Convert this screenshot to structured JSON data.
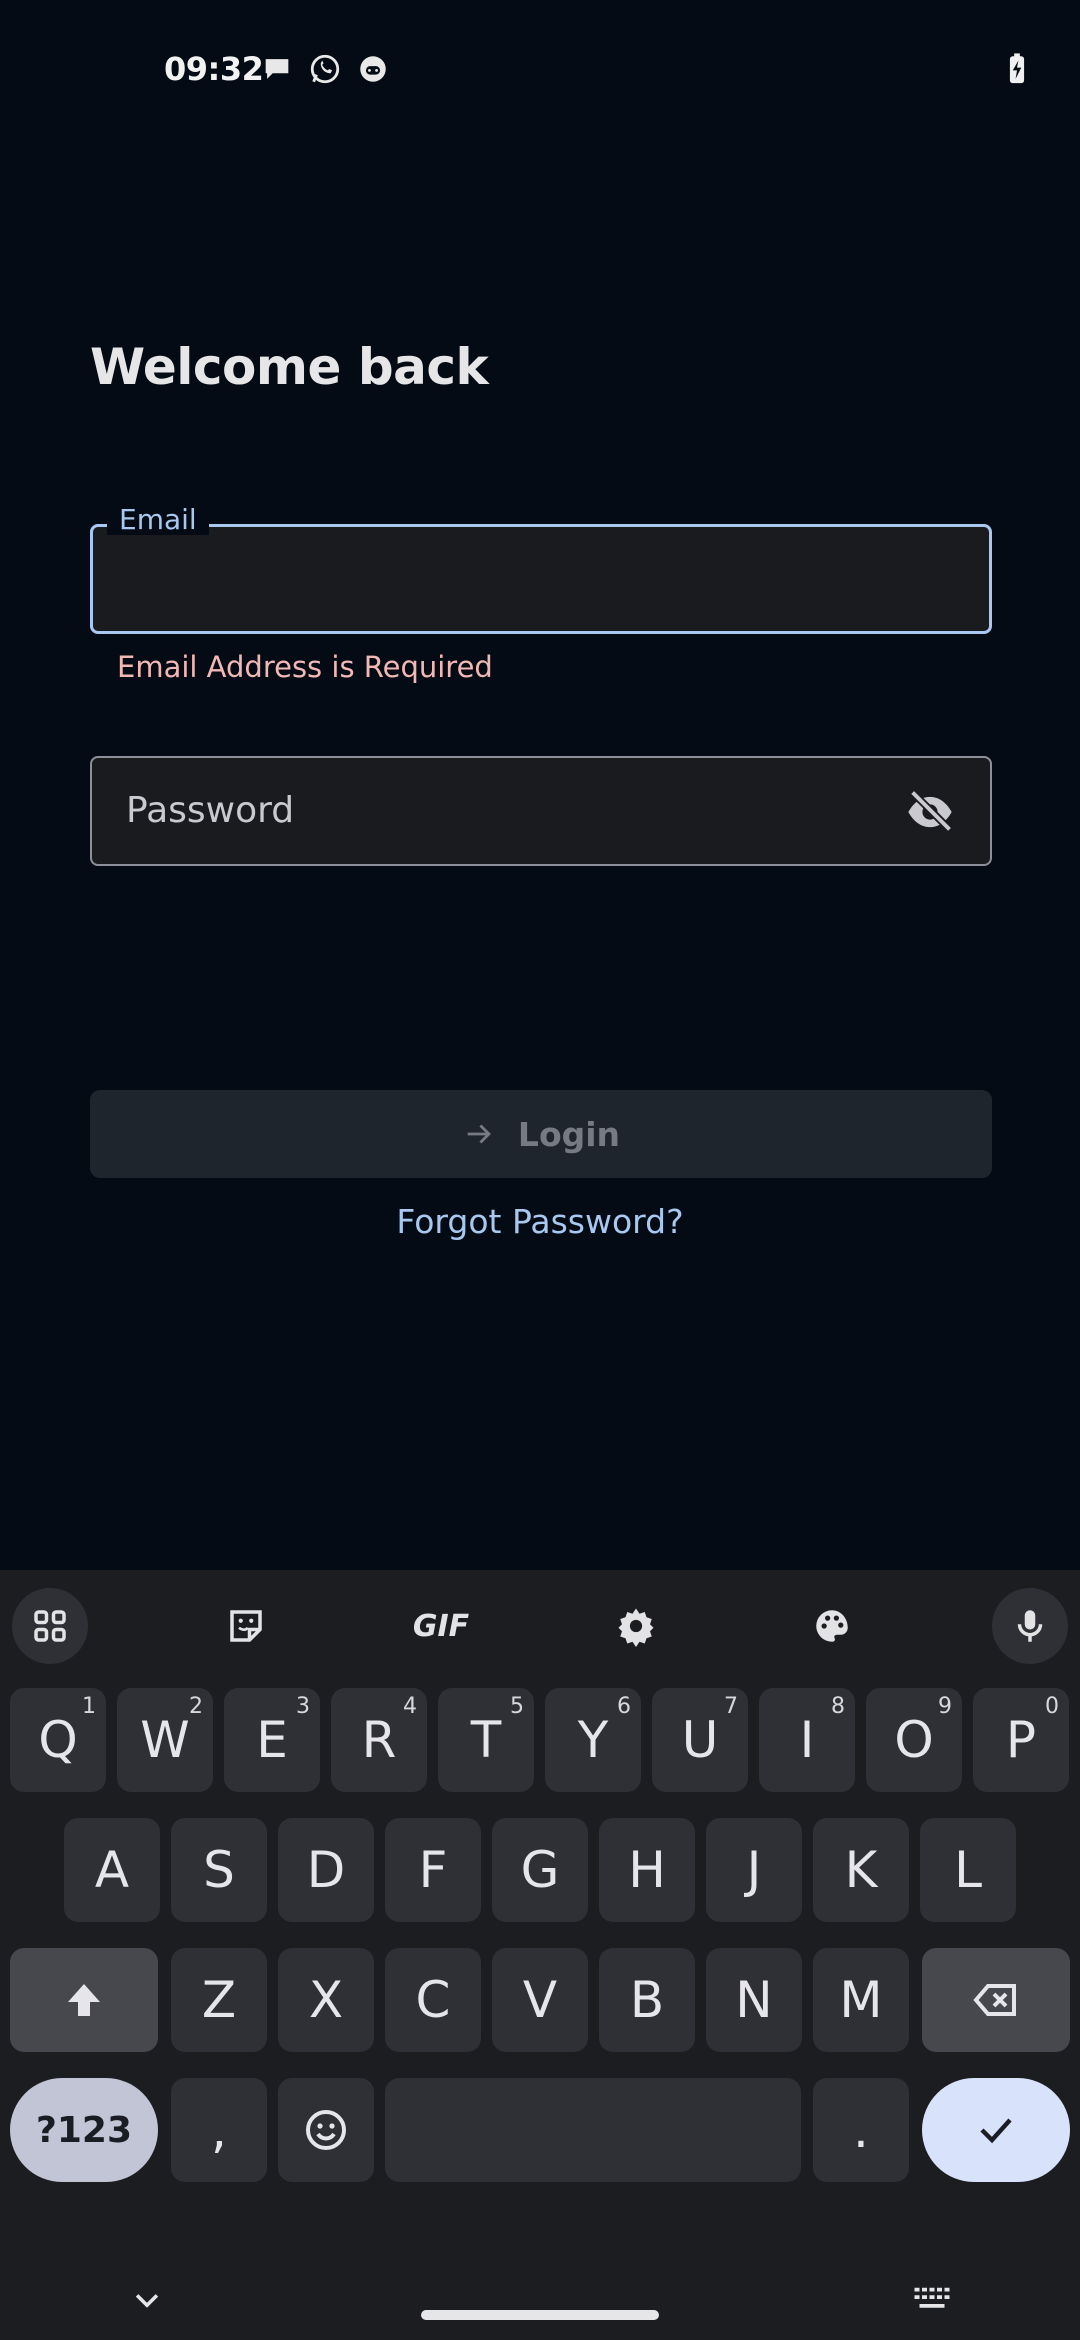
{
  "status_bar": {
    "time": "09:32",
    "icons": [
      "chat-bubble-icon",
      "whatsapp-icon",
      "assistant-icon"
    ],
    "battery": "battery-charging-icon"
  },
  "login": {
    "title": "Welcome back",
    "email_label": "Email",
    "email_value": "",
    "email_error": "Email Address is Required",
    "password_placeholder": "Password",
    "password_visibility_icon": "eye-off-icon",
    "login_label": "Login",
    "forgot_password": "Forgot Password?"
  },
  "colors": {
    "background": "#040b14",
    "accent": "#a8c8f0",
    "error": "#f2b8b5",
    "button_disabled": "#1f252d"
  },
  "keyboard": {
    "toolbar": [
      "apps-grid-icon",
      "sticker-icon",
      "GIF",
      "settings-icon",
      "palette-icon",
      "microphone-icon"
    ],
    "row1": [
      {
        "key": "Q",
        "hint": "1"
      },
      {
        "key": "W",
        "hint": "2"
      },
      {
        "key": "E",
        "hint": "3"
      },
      {
        "key": "R",
        "hint": "4"
      },
      {
        "key": "T",
        "hint": "5"
      },
      {
        "key": "Y",
        "hint": "6"
      },
      {
        "key": "U",
        "hint": "7"
      },
      {
        "key": "I",
        "hint": "8"
      },
      {
        "key": "O",
        "hint": "9"
      },
      {
        "key": "P",
        "hint": "0"
      }
    ],
    "row2": [
      "A",
      "S",
      "D",
      "F",
      "G",
      "H",
      "J",
      "K",
      "L"
    ],
    "row3": [
      "Z",
      "X",
      "C",
      "V",
      "B",
      "N",
      "M"
    ],
    "row4": {
      "symbols": "?123",
      "comma": ",",
      "period": "."
    }
  }
}
